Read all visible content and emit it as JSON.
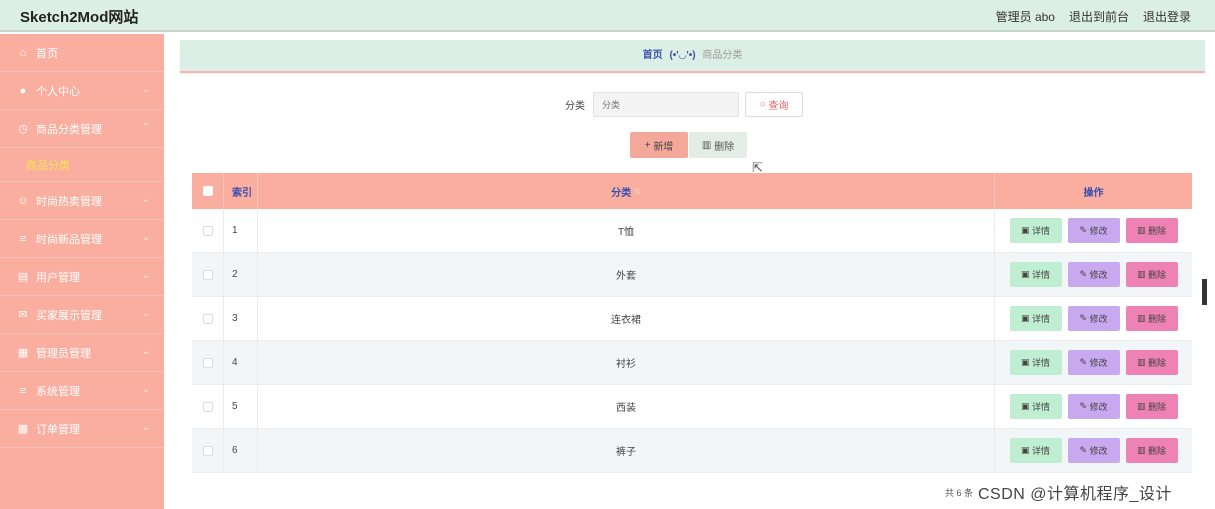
{
  "header": {
    "brand": "Sketch2Mod网站",
    "admin_label": "管理员 abo",
    "to_front": "退出到前台",
    "logout": "退出登录"
  },
  "sidebar": {
    "items": [
      {
        "label": "首页",
        "icon": "home-icon",
        "glyph": "⌂",
        "chevron": ""
      },
      {
        "label": "个人中心",
        "icon": "user-icon",
        "glyph": "●",
        "chevron": "⌄"
      },
      {
        "label": "商品分类管理",
        "icon": "clock-icon",
        "glyph": "◷",
        "chevron": "⌃"
      },
      {
        "label": "时尚热卖管理",
        "icon": "smile-icon",
        "glyph": "☺",
        "chevron": "⌄"
      },
      {
        "label": "时尚新品管理",
        "icon": "menu-icon",
        "glyph": "≡",
        "chevron": "⌄"
      },
      {
        "label": "用户管理",
        "icon": "document-icon",
        "glyph": "▤",
        "chevron": "⌄"
      },
      {
        "label": "买家展示管理",
        "icon": "mail-icon",
        "glyph": "✉",
        "chevron": "⌄"
      },
      {
        "label": "管理员管理",
        "icon": "grid-icon",
        "glyph": "▦",
        "chevron": "⌄"
      },
      {
        "label": "系统管理",
        "icon": "list-icon",
        "glyph": "≡",
        "chevron": "⌄"
      },
      {
        "label": "订单管理",
        "icon": "ticket-icon",
        "glyph": "▩",
        "chevron": "⌄"
      }
    ],
    "sub_item": "商品分类"
  },
  "breadcrumb": {
    "home": "首页",
    "face": "(•'◡'•)",
    "current": "商品分类"
  },
  "search": {
    "label": "分类",
    "placeholder": "分类",
    "button": "查询"
  },
  "actions": {
    "add": "新增",
    "delete": "删除"
  },
  "table": {
    "headers": {
      "index": "索引",
      "category": "分类",
      "ops": "操作"
    },
    "rows": [
      {
        "index": "1",
        "category": "T恤"
      },
      {
        "index": "2",
        "category": "外套"
      },
      {
        "index": "3",
        "category": "连衣裙"
      },
      {
        "index": "4",
        "category": "衬衫"
      },
      {
        "index": "5",
        "category": "西装"
      },
      {
        "index": "6",
        "category": "裤子"
      }
    ],
    "op_labels": {
      "detail": "详情",
      "edit": "修改",
      "delete": "删除"
    }
  },
  "footer": {
    "total": "共 6 条",
    "watermark": "CSDN @计算机程序_设计"
  }
}
